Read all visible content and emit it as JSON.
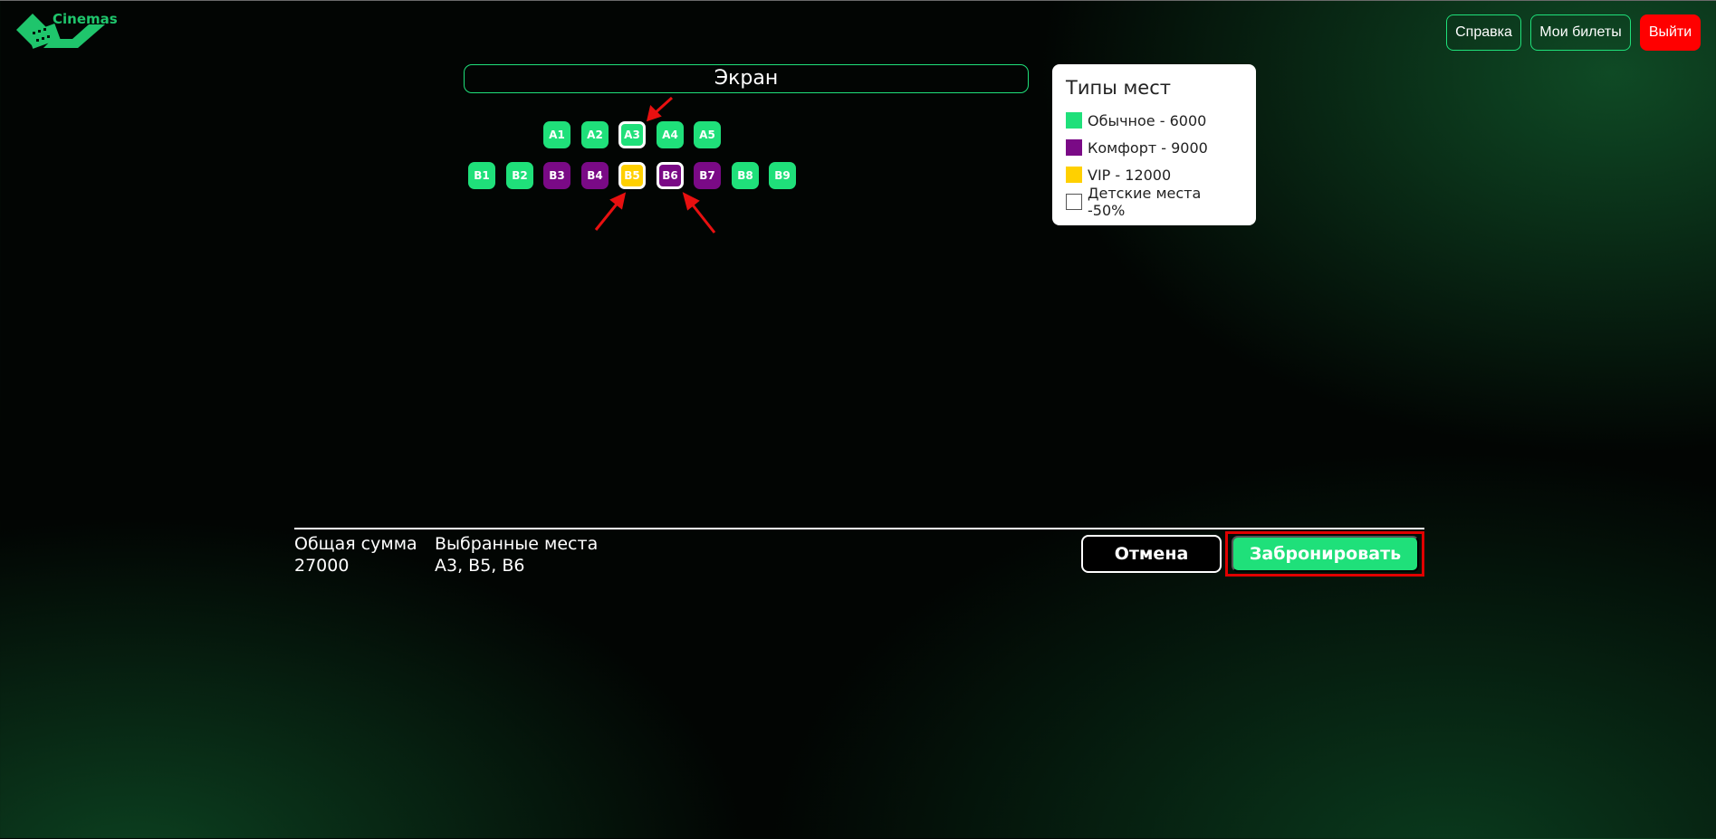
{
  "header": {
    "logo_text": "Cinemas",
    "help_label": "Справка",
    "tickets_label": "Мои билеты",
    "exit_label": "Выйти"
  },
  "hall": {
    "screen_label": "Экран",
    "rows": [
      [
        {
          "label": "A1",
          "type": "regular",
          "selected": false
        },
        {
          "label": "A2",
          "type": "regular",
          "selected": false
        },
        {
          "label": "A3",
          "type": "regular",
          "selected": true
        },
        {
          "label": "A4",
          "type": "regular",
          "selected": false
        },
        {
          "label": "A5",
          "type": "regular",
          "selected": false
        }
      ],
      [
        {
          "label": "B1",
          "type": "regular",
          "selected": false
        },
        {
          "label": "B2",
          "type": "regular",
          "selected": false
        },
        {
          "label": "B3",
          "type": "comfort",
          "selected": false
        },
        {
          "label": "B4",
          "type": "comfort",
          "selected": false
        },
        {
          "label": "B5",
          "type": "vip",
          "selected": true
        },
        {
          "label": "B6",
          "type": "comfort",
          "selected": true
        },
        {
          "label": "B7",
          "type": "comfort",
          "selected": false
        },
        {
          "label": "B8",
          "type": "regular",
          "selected": false
        },
        {
          "label": "B9",
          "type": "regular",
          "selected": false
        }
      ]
    ]
  },
  "legend": {
    "title": "Типы мест",
    "items": [
      {
        "label": "Обычное - 6000",
        "color": "#1fe07a"
      },
      {
        "label": "Комфорт - 9000",
        "color": "#7a0a86"
      },
      {
        "label": "VIP - 12000",
        "color": "#ffd000"
      },
      {
        "label": "Детские места -50%",
        "color": "#ffffff"
      }
    ]
  },
  "summary": {
    "total_label": "Общая сумма",
    "total_value": "27000",
    "seats_label": "Выбранные места",
    "seats_value": "A3, B5, B6"
  },
  "actions": {
    "cancel_label": "Отмена",
    "book_label": "Забронировать"
  },
  "colors": {
    "accent": "#1fe07a",
    "exit": "#ff0000",
    "highlight": "#e00000"
  }
}
